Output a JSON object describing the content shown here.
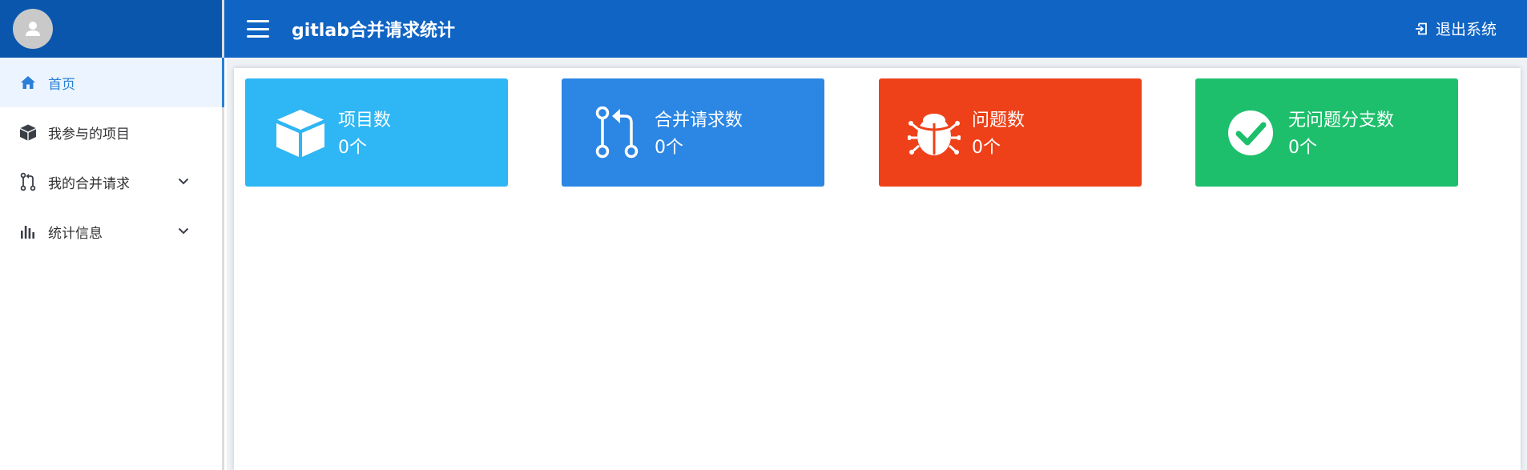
{
  "header": {
    "title": "gitlab合并请求统计",
    "logout_label": "退出系统"
  },
  "sidebar": {
    "items": [
      {
        "label": "首页",
        "icon": "home-icon",
        "active": true
      },
      {
        "label": "我参与的项目",
        "icon": "cube-icon"
      },
      {
        "label": "我的合并请求",
        "icon": "merge-request-icon",
        "expandable": true
      },
      {
        "label": "统计信息",
        "icon": "bar-chart-icon",
        "expandable": true
      }
    ]
  },
  "cards": [
    {
      "label": "项目数",
      "value": "0个",
      "icon": "cube-icon",
      "color": "#2eb6f5"
    },
    {
      "label": "合并请求数",
      "value": "0个",
      "icon": "merge-request-icon",
      "color": "#2b86e4"
    },
    {
      "label": "问题数",
      "value": "0个",
      "icon": "bug-icon",
      "color": "#ee4119"
    },
    {
      "label": "无问题分支数",
      "value": "0个",
      "icon": "check-circle-icon",
      "color": "#1dbf6c"
    }
  ],
  "colors": {
    "header": "#0f64c4",
    "sidebar_header": "#0a56ad",
    "active_item_bg": "#ecf5ff",
    "active_text": "#2a7fd7"
  }
}
